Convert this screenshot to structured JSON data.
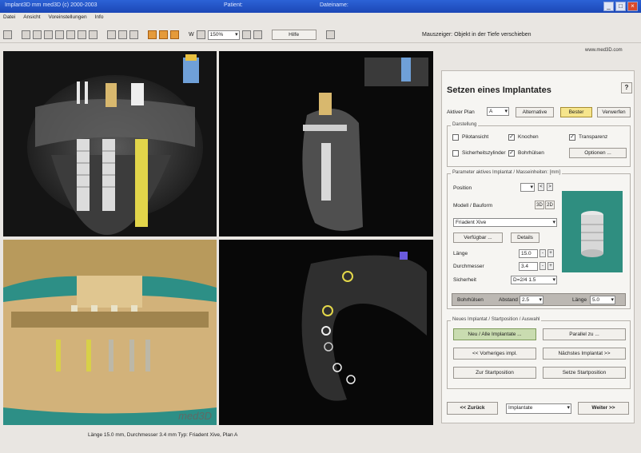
{
  "window": {
    "title": "Implant3D mm med3D (c) 2000-2003",
    "title_patient": "Patient:",
    "title_file": "Dateiname:"
  },
  "menu": [
    "Datei",
    "Ansicht",
    "Voreinstellungen",
    "Info"
  ],
  "toolbar": {
    "zoom_prefix": "W",
    "zoom_value": "150%",
    "help_label": "Hilfe",
    "hint": "Mauszeiger: Objekt in der Tiefe verschieben"
  },
  "logo": "www.med3D.com",
  "watermark": "med3D",
  "panel": {
    "title": "Setzen eines Implantates",
    "help": "?",
    "active_plan_label": "Aktiver Plan",
    "active_plan_value": "A",
    "alternative_label": "Alternative",
    "best_label": "Bester",
    "discard_label": "Verwerfen",
    "display_group": "Darstellung",
    "opt_pilot": "Pilotansicht",
    "opt_bone": "Knochen",
    "opt_transparency": "Transparenz",
    "opt_safety": "Sicherheitszylinder",
    "opt_drill": "Bohrhülsen",
    "options_button": "Optionen ...",
    "params_group": "Parameter aktives Implantat / Masseinheiten: [mm]",
    "position_label": "Position",
    "model_label": "Modell / Bauform",
    "model_code_1": "3D",
    "model_code_2": "2D",
    "model_value": "Friadent Xive",
    "available_button": "Verfügbar ...",
    "details_button": "Details",
    "length_label": "Länge",
    "length_value": "15.0",
    "diameter_label": "Durchmesser",
    "diameter_value": "3.4",
    "safety_label": "Sicherheit",
    "safety_value": "D=2/4 1.5",
    "drill_sleeve_label": "Bohrhülsen",
    "distance_label": "Abstand",
    "distance_value": "2.5",
    "sleeve_length_label": "Länge",
    "sleeve_length_value": "5.0",
    "new_group": "Neues Implantat / Startposition / Auswahl",
    "new_implant_button": "Neu / Alle Implantate ...",
    "parallel_button": "Parallel zu ...",
    "prev_button": "<< Vorheriges impl.",
    "next_button": "Nächstes Implantat >>",
    "to_start_button": "Zur Startposition",
    "set_start_button": "Setze Startposition",
    "back_button": "<< Zurück",
    "section_value": "Implantate",
    "next_step_button": "Weiter >>"
  },
  "status": "Länge 15.0 mm, Durchmesser 3.4 mm Typ: Friadent Xive, Plan A"
}
